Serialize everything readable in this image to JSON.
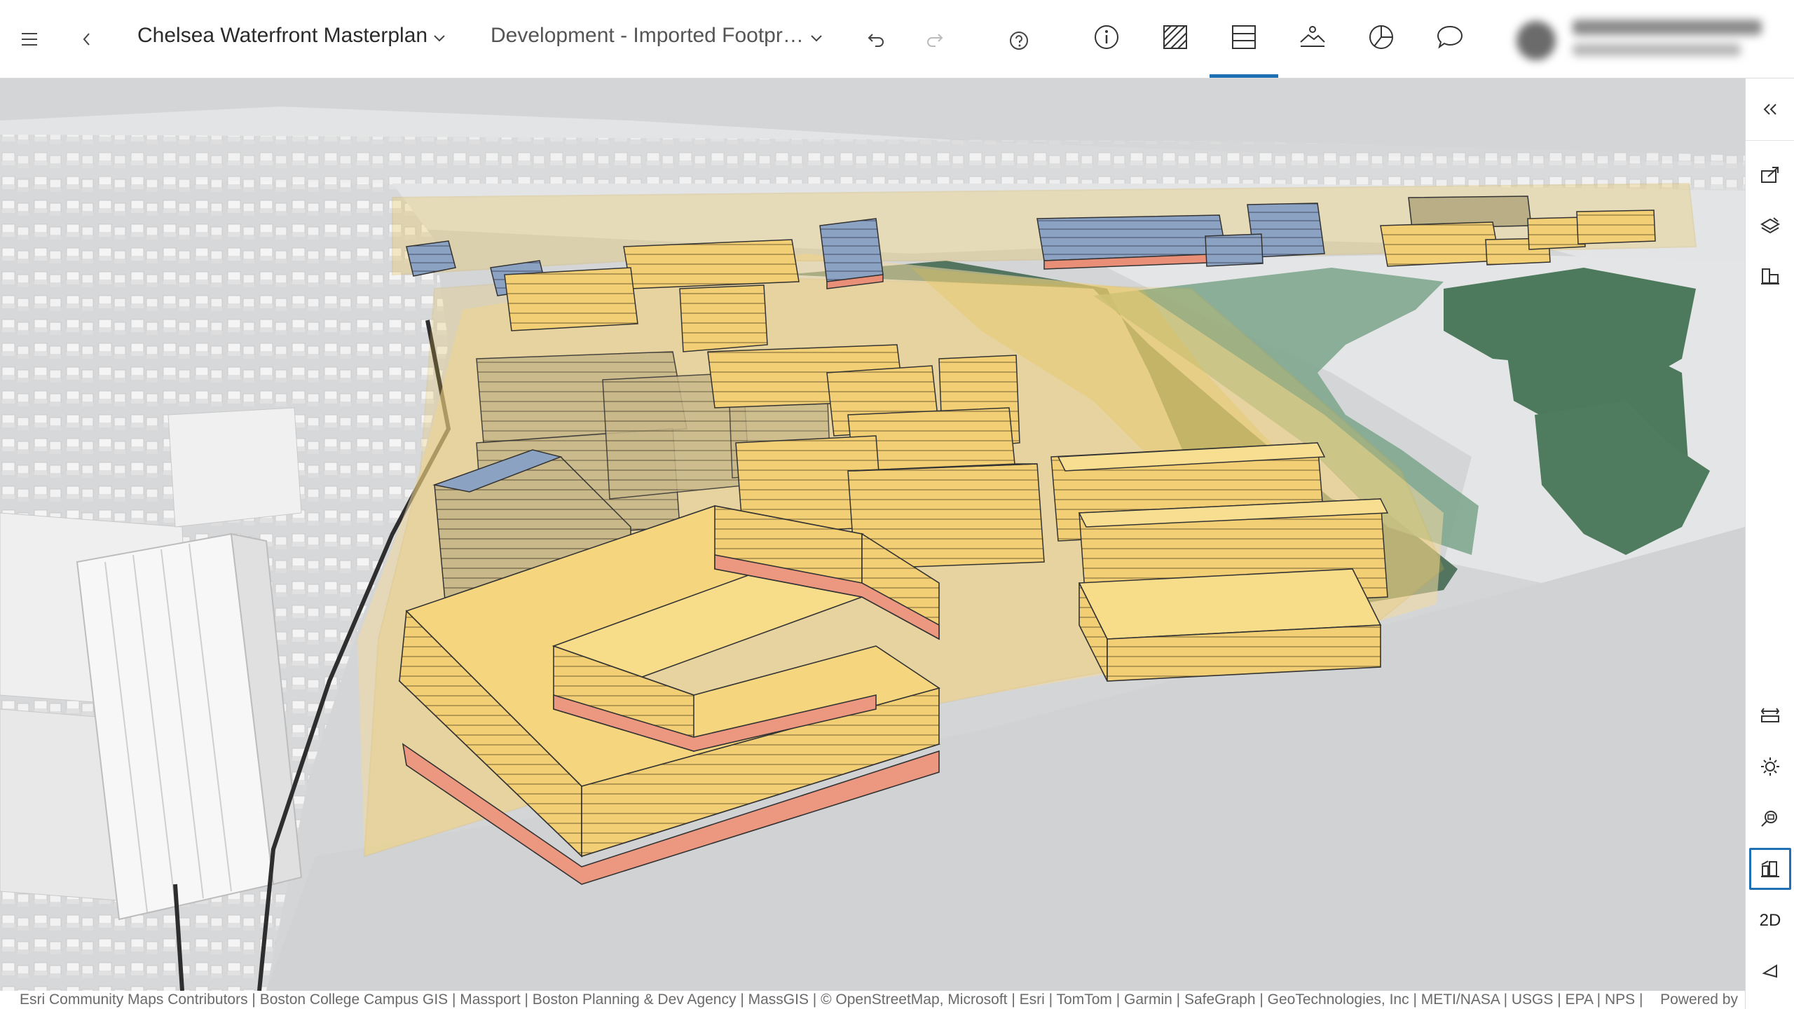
{
  "header": {
    "menu_icon": "hamburger-icon",
    "back_icon": "chevron-left-icon",
    "scene_title": "Chelsea Waterfront Masterplan",
    "scene_dropdown_icon": "chevron-down-icon",
    "scenario_title": "Development - Imported Footpr…",
    "scenario_dropdown_icon": "chevron-down-icon",
    "undo_icon": "undo-icon",
    "redo_icon": "redo-icon",
    "help_icon": "help-icon",
    "tools": [
      {
        "name": "info-icon",
        "active": false
      },
      {
        "name": "zones-icon",
        "active": false
      },
      {
        "name": "dashboard-icon",
        "active": true
      },
      {
        "name": "viewpoints-icon",
        "active": false
      },
      {
        "name": "chart-icon",
        "active": false
      },
      {
        "name": "comments-icon",
        "active": false
      }
    ],
    "active_color": "#1f6fb5"
  },
  "right_toolbar": {
    "collapse_icon": "double-chevron-left-icon",
    "top_tools": [
      "export-icon",
      "layers-icon",
      "buildings-icon"
    ],
    "bottom_tools": [
      "measure-icon",
      "daylight-icon",
      "search-zoom-icon",
      "analysis-icon"
    ],
    "active_tool": "analysis-icon",
    "view_mode_label": "2D",
    "compass_icon": "compass-icon"
  },
  "attribution": {
    "text": "Esri Community Maps Contributors | Boston College Campus GIS | Massport | Boston Planning & Dev Agency | MassGIS | © OpenStreetMap, Microsoft | Esri | TomTom | Garmin | SafeGraph | GeoTechnologies, Inc | METI/NASA | USGS | EPA | NPS | …",
    "powered_by": "Powered by"
  },
  "colors": {
    "building_yellow": "#f4d27a",
    "building_blue": "#8ea7c9",
    "building_base": "#e98f78",
    "envelope": "#f1c447",
    "park_green": "#4f7a5f",
    "water": "#d2d3d5"
  }
}
